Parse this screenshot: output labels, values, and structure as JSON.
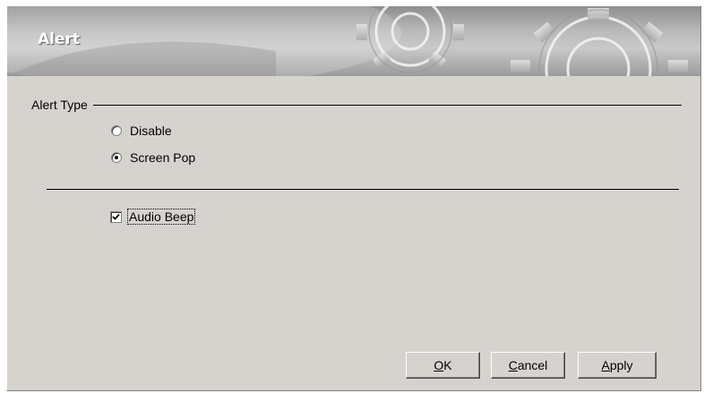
{
  "banner": {
    "title": "Alert",
    "decoration_icon": "gears-icon"
  },
  "alert_type": {
    "label": "Alert Type",
    "options": [
      {
        "label": "Disable",
        "selected": false
      },
      {
        "label": "Screen Pop",
        "selected": true
      }
    ]
  },
  "audio_beep": {
    "label": "Audio Beep",
    "checked": true
  },
  "buttons": {
    "ok": {
      "mnemonic": "O",
      "rest": "K"
    },
    "cancel": {
      "mnemonic": "C",
      "rest": "ancel"
    },
    "apply": {
      "mnemonic": "A",
      "rest": "pply"
    }
  },
  "colors": {
    "panel": "#d6d3ce",
    "banner_text": "#ffffff"
  }
}
